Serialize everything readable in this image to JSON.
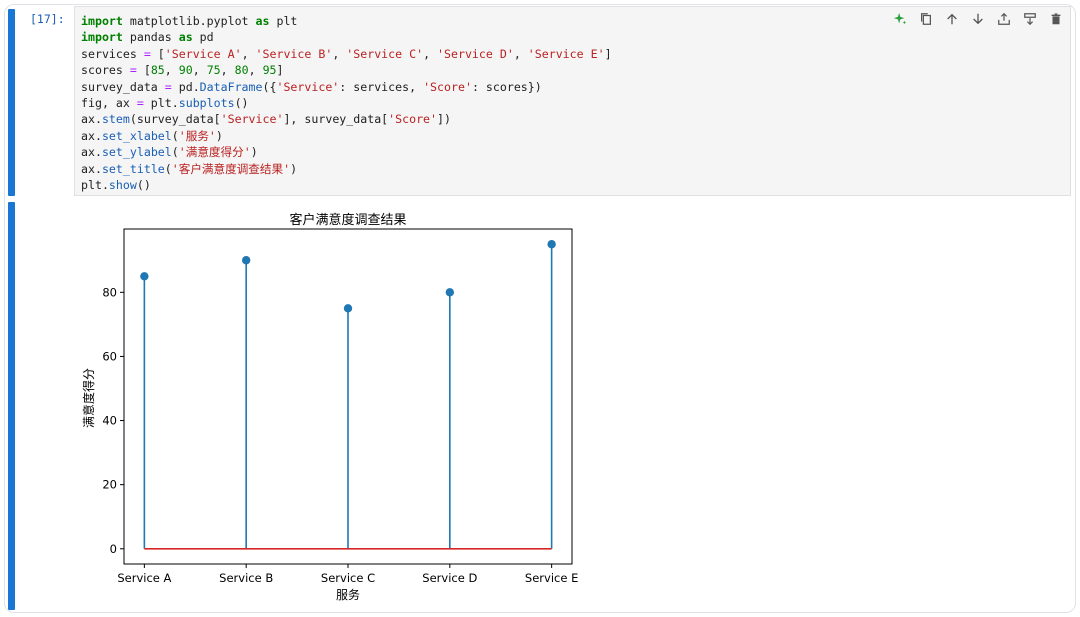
{
  "cell": {
    "prompt": "[17]:",
    "code_lines": [
      [
        [
          "kw",
          "import"
        ],
        [
          "t",
          " matplotlib.pyplot "
        ],
        [
          "kw",
          "as"
        ],
        [
          "t",
          " plt"
        ]
      ],
      [
        [
          "kw",
          "import"
        ],
        [
          "t",
          " pandas "
        ],
        [
          "kw",
          "as"
        ],
        [
          "t",
          " pd"
        ]
      ],
      [
        [
          "t",
          "services "
        ],
        [
          "op",
          "="
        ],
        [
          "t",
          " ["
        ],
        [
          "str",
          "'Service A'"
        ],
        [
          "t",
          ", "
        ],
        [
          "str",
          "'Service B'"
        ],
        [
          "t",
          ", "
        ],
        [
          "str",
          "'Service C'"
        ],
        [
          "t",
          ", "
        ],
        [
          "str",
          "'Service D'"
        ],
        [
          "t",
          ", "
        ],
        [
          "str",
          "'Service E'"
        ],
        [
          "t",
          "]"
        ]
      ],
      [
        [
          "t",
          "scores "
        ],
        [
          "op",
          "="
        ],
        [
          "t",
          " ["
        ],
        [
          "num",
          "85"
        ],
        [
          "t",
          ", "
        ],
        [
          "num",
          "90"
        ],
        [
          "t",
          ", "
        ],
        [
          "num",
          "75"
        ],
        [
          "t",
          ", "
        ],
        [
          "num",
          "80"
        ],
        [
          "t",
          ", "
        ],
        [
          "num",
          "95"
        ],
        [
          "t",
          "]"
        ]
      ],
      [
        [
          "t",
          "survey_data "
        ],
        [
          "op",
          "="
        ],
        [
          "t",
          " pd."
        ],
        [
          "fn",
          "DataFrame"
        ],
        [
          "t",
          "({"
        ],
        [
          "str",
          "'Service'"
        ],
        [
          "t",
          ": services, "
        ],
        [
          "str",
          "'Score'"
        ],
        [
          "t",
          ": scores})"
        ]
      ],
      [
        [
          "t",
          "fig, ax "
        ],
        [
          "op",
          "="
        ],
        [
          "t",
          " plt."
        ],
        [
          "fn",
          "subplots"
        ],
        [
          "t",
          "()"
        ]
      ],
      [
        [
          "t",
          "ax."
        ],
        [
          "fn",
          "stem"
        ],
        [
          "t",
          "(survey_data["
        ],
        [
          "str",
          "'Service'"
        ],
        [
          "t",
          "], survey_data["
        ],
        [
          "str",
          "'Score'"
        ],
        [
          "t",
          "])"
        ]
      ],
      [
        [
          "t",
          "ax."
        ],
        [
          "fn",
          "set_xlabel"
        ],
        [
          "t",
          "("
        ],
        [
          "str",
          "'服务'"
        ],
        [
          "t",
          ")"
        ]
      ],
      [
        [
          "t",
          "ax."
        ],
        [
          "fn",
          "set_ylabel"
        ],
        [
          "t",
          "("
        ],
        [
          "str",
          "'满意度得分'"
        ],
        [
          "t",
          ")"
        ]
      ],
      [
        [
          "t",
          "ax."
        ],
        [
          "fn",
          "set_title"
        ],
        [
          "t",
          "("
        ],
        [
          "str",
          "'客户满意度调查结果'"
        ],
        [
          "t",
          ")"
        ]
      ],
      [
        [
          "t",
          "plt."
        ],
        [
          "fn",
          "show"
        ],
        [
          "t",
          "()"
        ]
      ]
    ]
  },
  "toolbar": {
    "icons": [
      "sparkle-icon",
      "duplicate-icon",
      "move-up-icon",
      "move-down-icon",
      "insert-above-icon",
      "insert-below-icon",
      "delete-icon"
    ]
  },
  "colors": {
    "stem": "#1f77b4",
    "baseline": "#d62728",
    "accent": "#1976d2"
  },
  "chart_data": {
    "type": "stem",
    "title": "客户满意度调查结果",
    "xlabel": "服务",
    "ylabel": "满意度得分",
    "categories": [
      "Service A",
      "Service B",
      "Service C",
      "Service D",
      "Service E"
    ],
    "values": [
      85,
      90,
      75,
      80,
      95
    ],
    "yticks": [
      0,
      20,
      40,
      60,
      80
    ],
    "ylim": [
      -4.75,
      99.75
    ],
    "baseline": 0,
    "grid": false
  }
}
